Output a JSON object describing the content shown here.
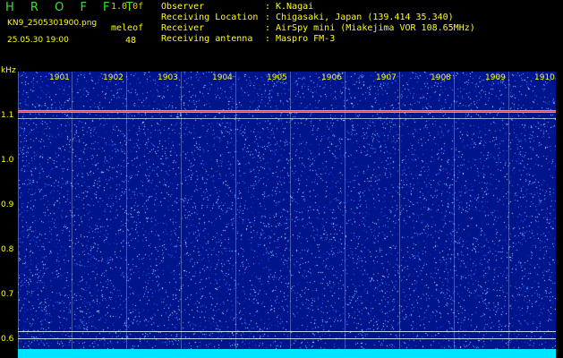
{
  "header": {
    "title": "H R O F F T",
    "version": "1.0.0f",
    "filename": "KN9_2505301900.png",
    "label2": "meleof",
    "datetime": "25.05.30 19:00",
    "value2": "48"
  },
  "info": [
    {
      "key": "Observer",
      "sep": ":",
      "value": "K.Nagai"
    },
    {
      "key": "Receiving Location",
      "sep": ":",
      "value": "Chigasaki, Japan (139.414 35.340)"
    },
    {
      "key": "Receiver",
      "sep": ":",
      "value": "AirSpy mini (Miakejima VOR 108.65MHz)"
    },
    {
      "key": "Receiving antenna",
      "sep": ":",
      "value": "Maspro FM-3"
    }
  ],
  "axis": {
    "unit": "kHz",
    "time_labels": [
      "1901",
      "1902",
      "1903",
      "1904",
      "1905",
      "1906",
      "1907",
      "1908",
      "1909",
      "1910"
    ],
    "freq_labels": [
      "1.1",
      "1.0",
      "0.9",
      "0.8",
      "0.7",
      "0.6"
    ]
  },
  "colors": {
    "background": "#000000",
    "spectrogram": "#00148c",
    "text": "#ffff00",
    "title": "#33e533",
    "carrier": "#ff4040",
    "baseline": "#00e5ff"
  }
}
